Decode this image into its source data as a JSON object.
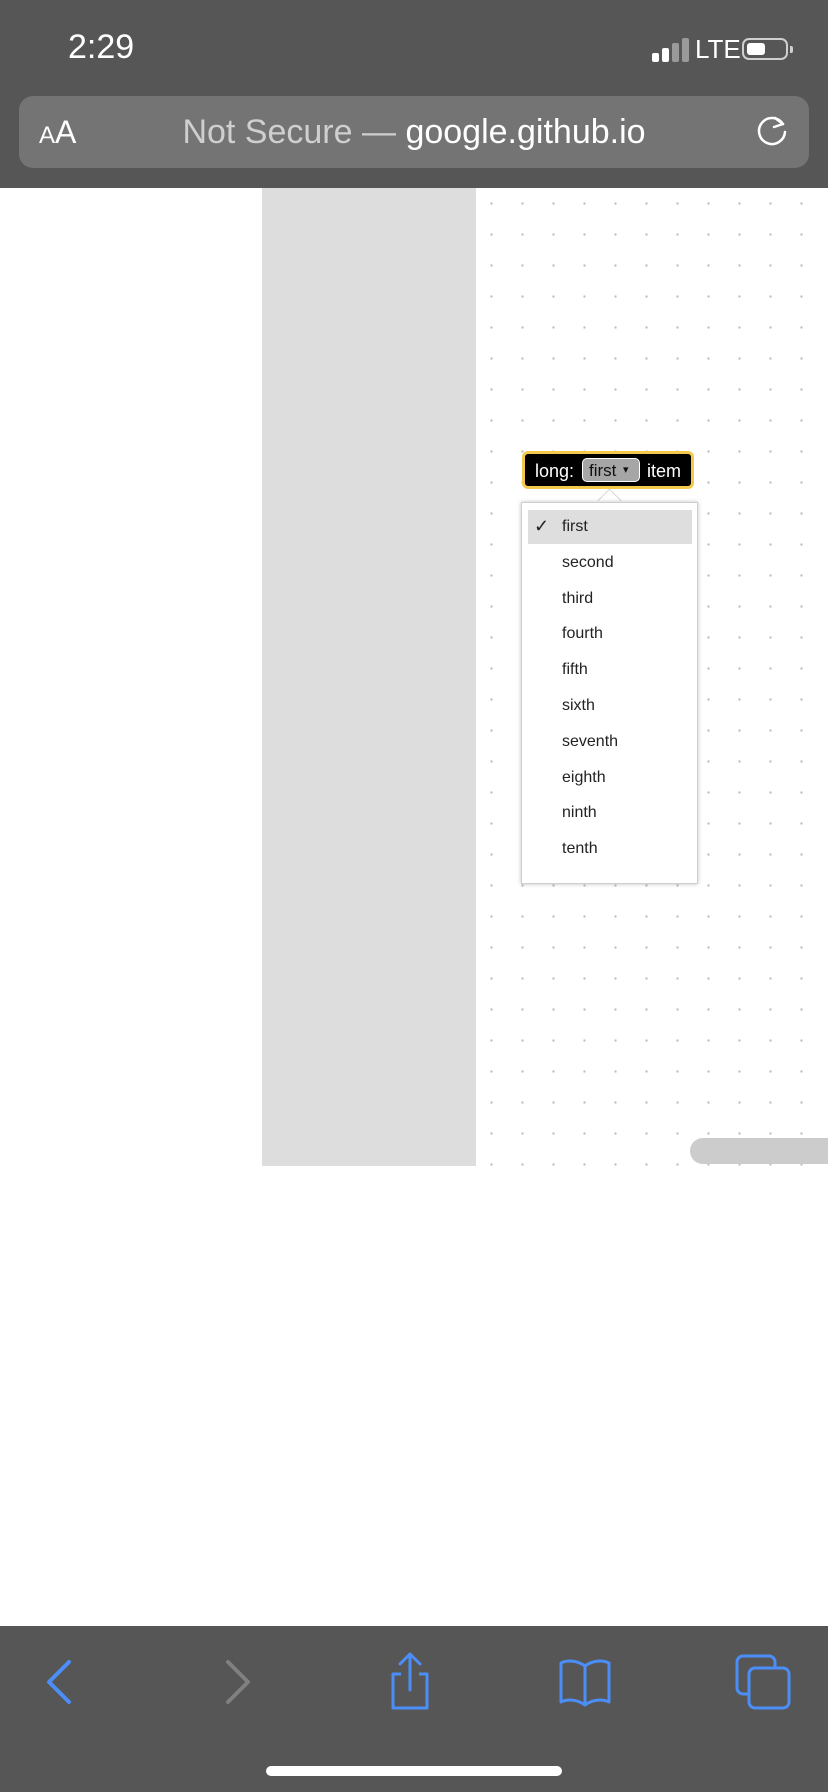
{
  "status": {
    "time": "2:29",
    "network": "LTE"
  },
  "address_bar": {
    "text_size_label_small": "A",
    "text_size_label_large": "A",
    "security": "Not Secure",
    "separator": "—",
    "domain": "google.github.io"
  },
  "block": {
    "prefix": "long:",
    "selected_value": "first",
    "dropdown_arrow": "▾",
    "suffix": "item"
  },
  "menu": {
    "checkmark": "✓",
    "items": [
      {
        "label": "first",
        "selected": true
      },
      {
        "label": "second"
      },
      {
        "label": "third"
      },
      {
        "label": "fourth"
      },
      {
        "label": "fifth"
      },
      {
        "label": "sixth"
      },
      {
        "label": "seventh"
      },
      {
        "label": "eighth"
      },
      {
        "label": "ninth"
      },
      {
        "label": "tenth"
      }
    ]
  },
  "toolbar": {
    "icons": [
      "back-icon",
      "forward-icon",
      "share-icon",
      "bookmarks-icon",
      "tabs-icon"
    ]
  },
  "colors": {
    "chrome": "#565656",
    "accent": "#4b8ef7",
    "block_highlight": "#f2c94c"
  }
}
